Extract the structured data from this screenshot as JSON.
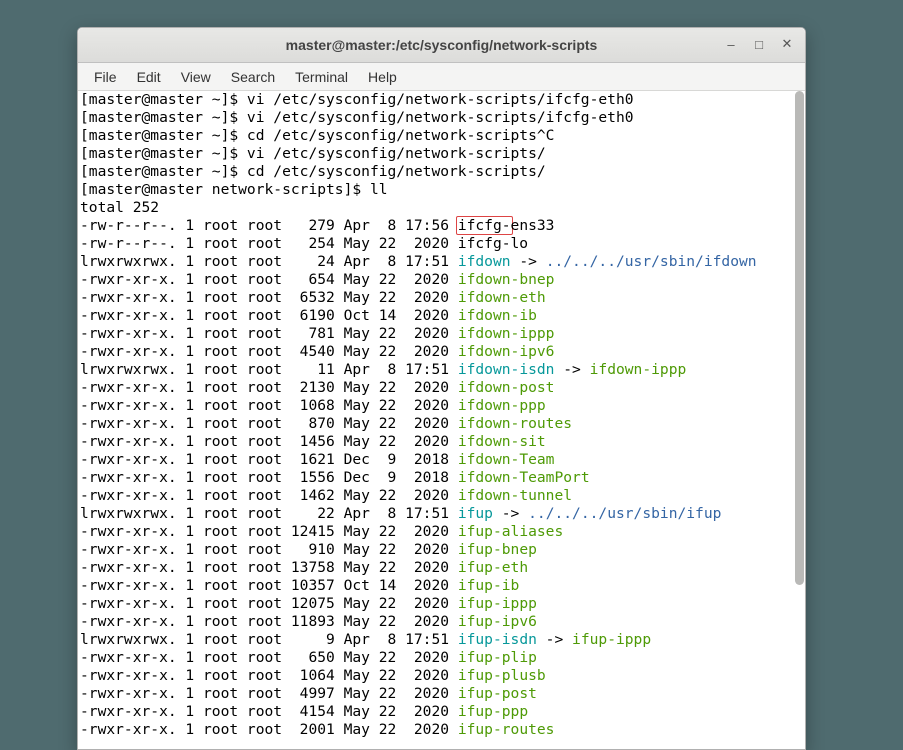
{
  "window": {
    "title": "master@master:/etc/sysconfig/network-scripts",
    "buttons": {
      "min": "–",
      "max": "□",
      "close": "✕"
    }
  },
  "menubar": [
    "File",
    "Edit",
    "View",
    "Search",
    "Terminal",
    "Help"
  ],
  "highlight_text": "ifcfg-",
  "prompt_lines": [
    {
      "prompt": "[master@master ~]$ ",
      "cmd": "vi /etc/sysconfig/network-scripts/ifcfg-eth0"
    },
    {
      "prompt": "[master@master ~]$ ",
      "cmd": "vi /etc/sysconfig/network-scripts/ifcfg-eth0"
    },
    {
      "prompt": "[master@master ~]$ ",
      "cmd": "cd /etc/sysconfig/network-scripts^C"
    },
    {
      "prompt": "[master@master ~]$ ",
      "cmd": "vi /etc/sysconfig/network-scripts/"
    },
    {
      "prompt": "[master@master ~]$ ",
      "cmd": "cd /etc/sysconfig/network-scripts/"
    },
    {
      "prompt": "[master@master network-scripts]$ ",
      "cmd": "ll"
    }
  ],
  "total_line": "total 252",
  "listing": [
    {
      "perm": "-rw-r--r--.",
      "l": "1",
      "o": "root",
      "g": "root",
      "sz": "279",
      "dt": "Apr  8 17:56",
      "pre": "ifcfg-",
      "name": "ens33",
      "type": "hl"
    },
    {
      "perm": "-rw-r--r--.",
      "l": "1",
      "o": "root",
      "g": "root",
      "sz": "254",
      "dt": "May 22  2020",
      "name": "ifcfg-lo",
      "type": "plain"
    },
    {
      "perm": "lrwxrwxrwx.",
      "l": "1",
      "o": "root",
      "g": "root",
      "sz": "24",
      "dt": "Apr  8 17:51",
      "name": "ifdown",
      "type": "link",
      "arrow": " -> ",
      "target": "../../../usr/sbin/ifdown",
      "tcolor": "blue"
    },
    {
      "perm": "-rwxr-xr-x.",
      "l": "1",
      "o": "root",
      "g": "root",
      "sz": "654",
      "dt": "May 22  2020",
      "name": "ifdown-bnep",
      "type": "exec"
    },
    {
      "perm": "-rwxr-xr-x.",
      "l": "1",
      "o": "root",
      "g": "root",
      "sz": "6532",
      "dt": "May 22  2020",
      "name": "ifdown-eth",
      "type": "exec"
    },
    {
      "perm": "-rwxr-xr-x.",
      "l": "1",
      "o": "root",
      "g": "root",
      "sz": "6190",
      "dt": "Oct 14  2020",
      "name": "ifdown-ib",
      "type": "exec"
    },
    {
      "perm": "-rwxr-xr-x.",
      "l": "1",
      "o": "root",
      "g": "root",
      "sz": "781",
      "dt": "May 22  2020",
      "name": "ifdown-ippp",
      "type": "exec"
    },
    {
      "perm": "-rwxr-xr-x.",
      "l": "1",
      "o": "root",
      "g": "root",
      "sz": "4540",
      "dt": "May 22  2020",
      "name": "ifdown-ipv6",
      "type": "exec"
    },
    {
      "perm": "lrwxrwxrwx.",
      "l": "1",
      "o": "root",
      "g": "root",
      "sz": "11",
      "dt": "Apr  8 17:51",
      "name": "ifdown-isdn",
      "type": "link",
      "arrow": " -> ",
      "target": "ifdown-ippp",
      "tcolor": "green"
    },
    {
      "perm": "-rwxr-xr-x.",
      "l": "1",
      "o": "root",
      "g": "root",
      "sz": "2130",
      "dt": "May 22  2020",
      "name": "ifdown-post",
      "type": "exec"
    },
    {
      "perm": "-rwxr-xr-x.",
      "l": "1",
      "o": "root",
      "g": "root",
      "sz": "1068",
      "dt": "May 22  2020",
      "name": "ifdown-ppp",
      "type": "exec"
    },
    {
      "perm": "-rwxr-xr-x.",
      "l": "1",
      "o": "root",
      "g": "root",
      "sz": "870",
      "dt": "May 22  2020",
      "name": "ifdown-routes",
      "type": "exec"
    },
    {
      "perm": "-rwxr-xr-x.",
      "l": "1",
      "o": "root",
      "g": "root",
      "sz": "1456",
      "dt": "May 22  2020",
      "name": "ifdown-sit",
      "type": "exec"
    },
    {
      "perm": "-rwxr-xr-x.",
      "l": "1",
      "o": "root",
      "g": "root",
      "sz": "1621",
      "dt": "Dec  9  2018",
      "name": "ifdown-Team",
      "type": "exec"
    },
    {
      "perm": "-rwxr-xr-x.",
      "l": "1",
      "o": "root",
      "g": "root",
      "sz": "1556",
      "dt": "Dec  9  2018",
      "name": "ifdown-TeamPort",
      "type": "exec"
    },
    {
      "perm": "-rwxr-xr-x.",
      "l": "1",
      "o": "root",
      "g": "root",
      "sz": "1462",
      "dt": "May 22  2020",
      "name": "ifdown-tunnel",
      "type": "exec"
    },
    {
      "perm": "lrwxrwxrwx.",
      "l": "1",
      "o": "root",
      "g": "root",
      "sz": "22",
      "dt": "Apr  8 17:51",
      "name": "ifup",
      "type": "link",
      "arrow": " -> ",
      "target": "../../../usr/sbin/ifup",
      "tcolor": "blue"
    },
    {
      "perm": "-rwxr-xr-x.",
      "l": "1",
      "o": "root",
      "g": "root",
      "sz": "12415",
      "dt": "May 22  2020",
      "name": "ifup-aliases",
      "type": "exec"
    },
    {
      "perm": "-rwxr-xr-x.",
      "l": "1",
      "o": "root",
      "g": "root",
      "sz": "910",
      "dt": "May 22  2020",
      "name": "ifup-bnep",
      "type": "exec"
    },
    {
      "perm": "-rwxr-xr-x.",
      "l": "1",
      "o": "root",
      "g": "root",
      "sz": "13758",
      "dt": "May 22  2020",
      "name": "ifup-eth",
      "type": "exec"
    },
    {
      "perm": "-rwxr-xr-x.",
      "l": "1",
      "o": "root",
      "g": "root",
      "sz": "10357",
      "dt": "Oct 14  2020",
      "name": "ifup-ib",
      "type": "exec"
    },
    {
      "perm": "-rwxr-xr-x.",
      "l": "1",
      "o": "root",
      "g": "root",
      "sz": "12075",
      "dt": "May 22  2020",
      "name": "ifup-ippp",
      "type": "exec"
    },
    {
      "perm": "-rwxr-xr-x.",
      "l": "1",
      "o": "root",
      "g": "root",
      "sz": "11893",
      "dt": "May 22  2020",
      "name": "ifup-ipv6",
      "type": "exec"
    },
    {
      "perm": "lrwxrwxrwx.",
      "l": "1",
      "o": "root",
      "g": "root",
      "sz": "9",
      "dt": "Apr  8 17:51",
      "name": "ifup-isdn",
      "type": "link",
      "arrow": " -> ",
      "target": "ifup-ippp",
      "tcolor": "green"
    },
    {
      "perm": "-rwxr-xr-x.",
      "l": "1",
      "o": "root",
      "g": "root",
      "sz": "650",
      "dt": "May 22  2020",
      "name": "ifup-plip",
      "type": "exec"
    },
    {
      "perm": "-rwxr-xr-x.",
      "l": "1",
      "o": "root",
      "g": "root",
      "sz": "1064",
      "dt": "May 22  2020",
      "name": "ifup-plusb",
      "type": "exec"
    },
    {
      "perm": "-rwxr-xr-x.",
      "l": "1",
      "o": "root",
      "g": "root",
      "sz": "4997",
      "dt": "May 22  2020",
      "name": "ifup-post",
      "type": "exec"
    },
    {
      "perm": "-rwxr-xr-x.",
      "l": "1",
      "o": "root",
      "g": "root",
      "sz": "4154",
      "dt": "May 22  2020",
      "name": "ifup-ppp",
      "type": "exec"
    },
    {
      "perm": "-rwxr-xr-x.",
      "l": "1",
      "o": "root",
      "g": "root",
      "sz": "2001",
      "dt": "May 22  2020",
      "name": "ifup-routes",
      "type": "exec"
    }
  ]
}
